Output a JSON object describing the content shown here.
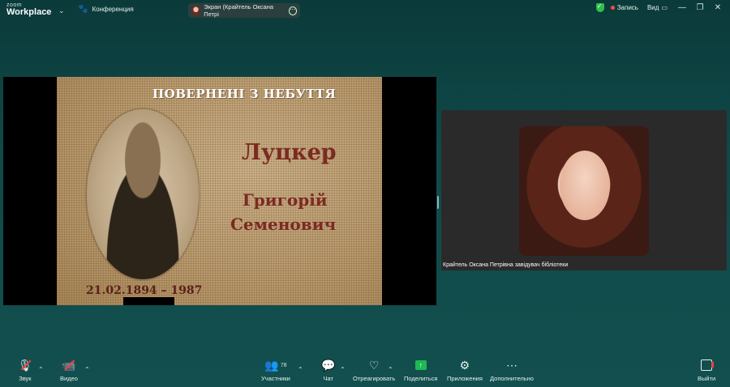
{
  "app": {
    "brand_small": "zoom",
    "brand_large": "Workplace"
  },
  "topbar": {
    "conference_label": "Конференция",
    "screen_share_label": "Экран (Крайтель Оксана Петрі",
    "record_label": "Запись",
    "view_label": "Вид",
    "colors": {
      "secure": "#2fbf4a",
      "record_dot": "#ff4a3d"
    }
  },
  "slide": {
    "title": "ПОВЕРНЕНІ З НЕБУТТЯ",
    "surname": "Луцкер",
    "name": "Григорій",
    "patronymic": "Семенович",
    "dates": "21.02.1894 – 1987"
  },
  "participant": {
    "name_label": "Крайтель Оксана Петрівна завідувач бібліотеки"
  },
  "toolbar": {
    "audio_label": "Звук",
    "video_label": "Видео",
    "participants_label": "Участники",
    "participants_count": "78",
    "chat_label": "Чат",
    "react_label": "Отреагировать",
    "share_label": "Поделиться",
    "apps_label": "Приложения",
    "more_label": "Дополнительно",
    "leave_label": "Выйти",
    "icons": [
      "microphone-muted-icon",
      "camera-muted-icon",
      "participants-icon",
      "chat-icon",
      "heart-icon",
      "share-screen-icon",
      "apps-icon",
      "more-icon",
      "leave-icon"
    ]
  }
}
